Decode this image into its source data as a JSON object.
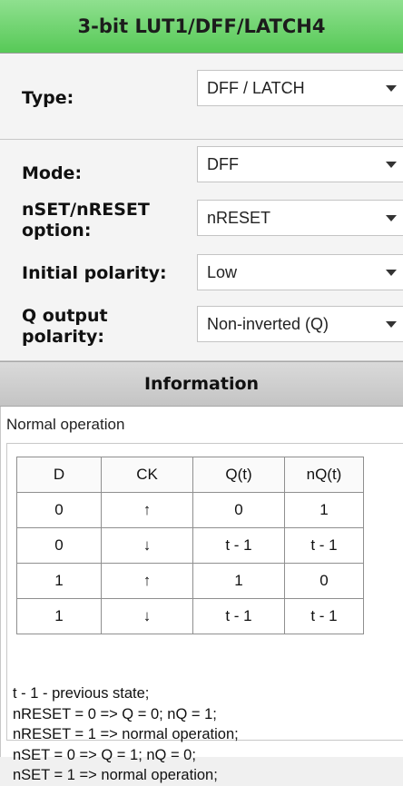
{
  "header": {
    "title": "3-bit LUT1/DFF/LATCH4"
  },
  "type_section": {
    "label": "Type:",
    "value": "DFF / LATCH"
  },
  "options": {
    "mode": {
      "label": "Mode:",
      "value": "DFF"
    },
    "nset_nreset": {
      "label_line1": "nSET/nRESET",
      "label_line2": "option:",
      "value": "nRESET"
    },
    "initial_polarity": {
      "label": "Initial polarity:",
      "value": "Low"
    },
    "q_output": {
      "label_line1": "Q output",
      "label_line2": "polarity:",
      "value": "Non-inverted (Q)"
    }
  },
  "information": {
    "title": "Information",
    "subtitle": "Normal operation",
    "table": {
      "headers": [
        "D",
        "CK",
        "Q(t)",
        "nQ(t)"
      ],
      "rows": [
        [
          "0",
          "↑",
          "0",
          "1"
        ],
        [
          "0",
          "↓",
          "t - 1",
          "t - 1"
        ],
        [
          "1",
          "↑",
          "1",
          "0"
        ],
        [
          "1",
          "↓",
          "t - 1",
          "t - 1"
        ]
      ]
    },
    "notes": [
      "t - 1 - previous state;",
      "nRESET = 0 => Q = 0; nQ = 1;",
      "nRESET = 1 => normal operation;",
      "nSET = 0 => Q = 1; nQ = 0;",
      "nSET = 1 => normal operation;"
    ]
  },
  "colors": {
    "header_green": "#57c957",
    "panel_bg": "#f4f4f4",
    "info_bar_gray": "#cccccc"
  },
  "icons": {
    "dropdown": "chevron-down-icon"
  }
}
